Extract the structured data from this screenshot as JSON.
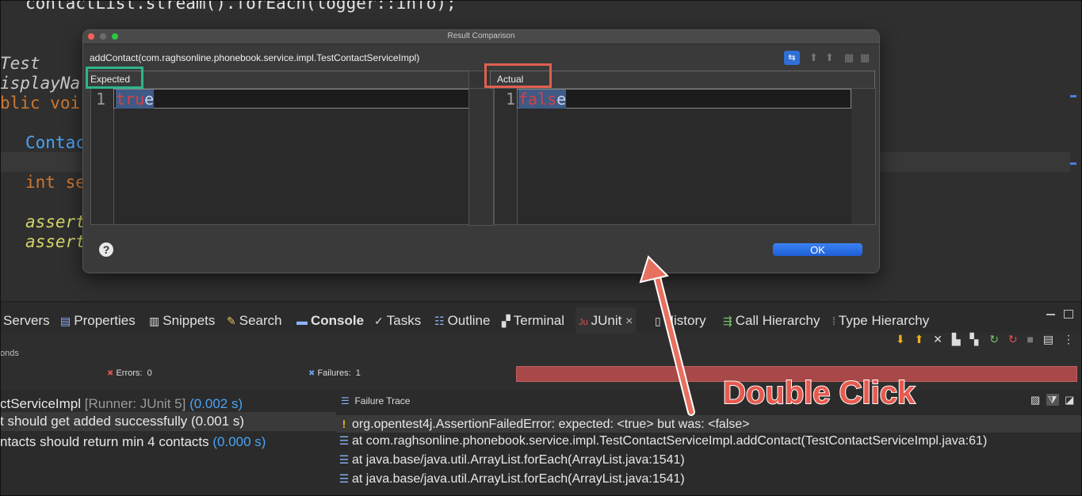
{
  "editor": {
    "lines": [
      {
        "text": "contactList.stream().forEach(logger::info);",
        "color": "#e6e6e6"
      },
      {
        "text": "Test",
        "color": "#c8c8c8"
      },
      {
        "text": "isplayNa",
        "color": "#c8c8c8"
      },
      {
        "text": "blic voi",
        "color": "#cc7832"
      },
      {
        "text": "Contac",
        "color": "#4aa3f5"
      },
      {
        "text": "int se",
        "color": "#cc7832"
      },
      {
        "text": "assert",
        "color": "#d4d46a"
      },
      {
        "text": "assert",
        "color": "#d4d46a"
      }
    ]
  },
  "dialog": {
    "title": "Result Comparison",
    "test_name": "addContact(com.raghsonline.phonebook.service.impl.TestContactServiceImpl)",
    "expected_label": "Expected",
    "actual_label": "Actual",
    "line_number": "1",
    "expected_value": {
      "diff": "tru",
      "same": "e"
    },
    "actual_value": {
      "diff": "fals",
      "same": "e"
    },
    "ok_label": "OK",
    "help_glyph": "?"
  },
  "tabs": [
    {
      "label": "Servers",
      "icon": "servers-icon"
    },
    {
      "label": "Properties",
      "icon": "properties-icon"
    },
    {
      "label": "Snippets",
      "icon": "snippets-icon"
    },
    {
      "label": "Search",
      "icon": "search-icon"
    },
    {
      "label": "Console",
      "icon": "console-icon"
    },
    {
      "label": "Tasks",
      "icon": "tasks-icon"
    },
    {
      "label": "Outline",
      "icon": "outline-icon"
    },
    {
      "label": "Terminal",
      "icon": "terminal-icon"
    },
    {
      "label": "JUnit",
      "icon": "junit-icon",
      "close": "×"
    },
    {
      "label": "History",
      "icon": "history-icon"
    },
    {
      "label": "Call Hierarchy",
      "icon": "call-hierarchy-icon"
    },
    {
      "label": "Type Hierarchy",
      "icon": "type-hierarchy-icon"
    }
  ],
  "junit": {
    "seconds_fragment": "onds",
    "errors_label": "Errors:",
    "errors_value": "0",
    "failures_label": "Failures:",
    "failures_value": "1",
    "progress_color": "#a84848",
    "results": [
      {
        "name": "ctServiceImpl",
        "runner": "[Runner: JUnit 5]",
        "time": "(0.002 s)"
      },
      {
        "name": "t should get added successfully",
        "time": "(0.001 s)"
      },
      {
        "name": "ntacts should return min 4 contacts",
        "time": "(0.000 s)"
      }
    ],
    "failure_trace_title": "Failure Trace",
    "trace": [
      "org.opentest4j.AssertionFailedError: expected: <true> but was: <false>",
      "at com.raghsonline.phonebook.service.impl.TestContactServiceImpl.addContact(TestContactServiceImpl.java:61)",
      "at java.base/java.util.ArrayList.forEach(ArrayList.java:1541)",
      "at java.base/java.util.ArrayList.forEach(ArrayList.java:1541)"
    ]
  },
  "annotation": {
    "text": "Double Click",
    "arrow_color": "#e8705f",
    "expected_box_color": "#2fb48c",
    "actual_box_color": "#e0604f"
  }
}
